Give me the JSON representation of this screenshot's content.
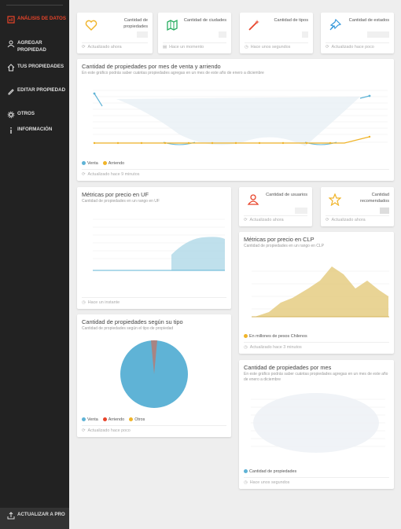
{
  "sidebar": {
    "items": [
      {
        "label": "Análisis de datos",
        "icon": "chart-icon"
      },
      {
        "label": "Agregar propiedad",
        "icon": "user-add-icon"
      },
      {
        "label": "Tus propiedades",
        "icon": "home-icon"
      },
      {
        "label": "Editar propiedad",
        "icon": "pencil-icon"
      },
      {
        "label": "Otros",
        "icon": "gear-icon"
      },
      {
        "label": "Información",
        "icon": "info-icon"
      }
    ],
    "upgrade_label": "Actualizar a Pro"
  },
  "stats_top": [
    {
      "label": "Cantidad de propiedades",
      "footer": "Actualizado ahora",
      "icon": "heart-icon",
      "color": "#f0b429"
    },
    {
      "label": "Cantidad de ciudades",
      "footer": "Hace un momento",
      "icon": "map-icon",
      "color": "#27ae60"
    },
    {
      "label": "Cantidad de tipos",
      "footer": "Hace unos segundos",
      "icon": "wand-icon",
      "color": "#e8442a"
    },
    {
      "label": "Cantidad de estados",
      "footer": "Actualizado hace poco",
      "icon": "pin-icon",
      "color": "#3498db"
    }
  ],
  "stats_mid": [
    {
      "label": "Cantidad de usuarios",
      "footer": "Actualizado ahora",
      "icon": "person-icon",
      "color": "#e8442a"
    },
    {
      "label": "Cantidad recomendados",
      "footer": "Actualizado ahora",
      "icon": "star-icon",
      "color": "#f0b429"
    }
  ],
  "line_chart": {
    "title": "Cantidad de propiedades por mes de venta y arriendo",
    "subtitle": "En este gráfico podrás saber cuántas propiedades agregas en un mes de este año de enero a diciembre",
    "legend": [
      {
        "name": "Venta",
        "color": "#5fb3d6"
      },
      {
        "name": "Arriendo",
        "color": "#f0b429"
      }
    ],
    "footer": "Actualizado hace 9 minutos"
  },
  "uf_chart": {
    "title": "Métricas por precio en UF",
    "subtitle": "Cantidad de propiedades en un rango en UF",
    "footer": "Hace un instante"
  },
  "clp_chart": {
    "title": "Métricas por precio en CLP",
    "subtitle": "Cantidad de propiedades en un rango en CLP",
    "legend": [
      {
        "name": "En millones de pesos Chilenos",
        "color": "#f0b429"
      }
    ],
    "footer": "Actualizado hace 3 minutos"
  },
  "type_chart": {
    "title": "Cantidad de propiedades según su tipo",
    "subtitle": "Cantidad de propiedades según el tipo de propiedad",
    "legend": [
      {
        "name": "Venta",
        "color": "#5fb3d6"
      },
      {
        "name": "Arriendo",
        "color": "#e8442a"
      },
      {
        "name": "Otros",
        "color": "#f0b429"
      }
    ],
    "footer": "Actualizado hace poco"
  },
  "month_chart": {
    "title": "Cantidad de propiedades por mes",
    "subtitle": "En este gráfico podrás saber cuántas propiedades agregas en un mes de este año de enero a diciembre",
    "legend": [
      {
        "name": "Cantidad de propiedades",
        "color": "#5fb3d6"
      }
    ],
    "footer": "Hace unos segundos"
  }
}
